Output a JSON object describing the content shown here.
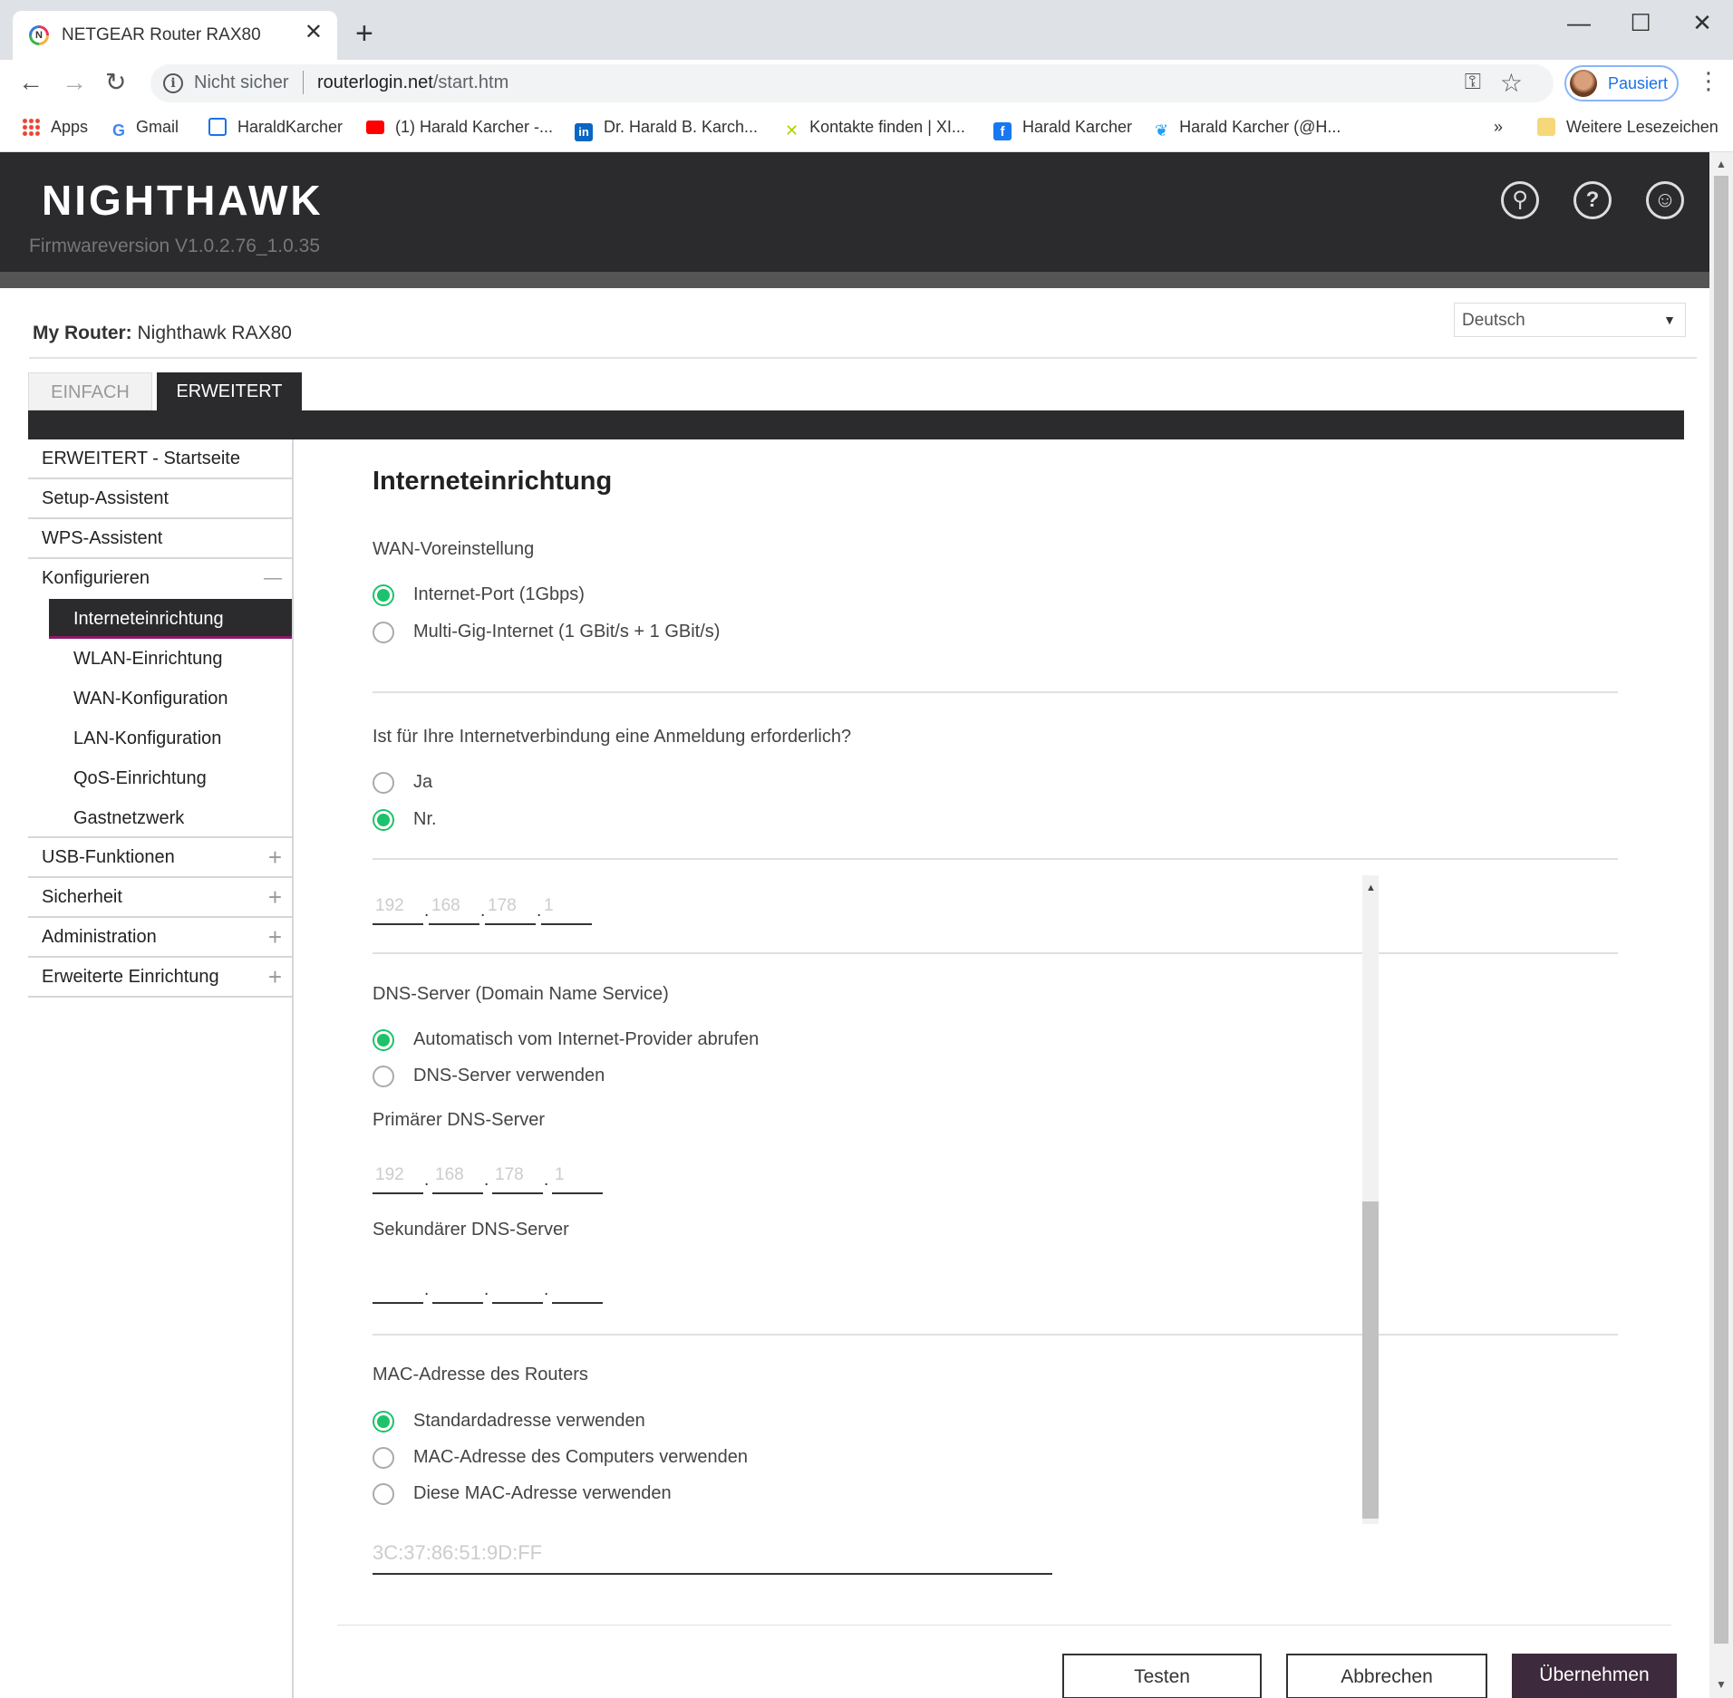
{
  "browser": {
    "tab_title": "NETGEAR Router RAX80",
    "tab_close": "✕",
    "new_tab": "+",
    "window_controls": {
      "minimize": "—",
      "maximize": "☐",
      "close": "✕"
    },
    "nav": {
      "back": "←",
      "forward": "→",
      "reload": "↻"
    },
    "security_label": "Nicht sicher",
    "url_host": "routerlogin.net",
    "url_path": "/start.htm",
    "profile_label": "Pausiert",
    "menu": "⋮",
    "bookmarks": [
      {
        "label": "Apps",
        "icon": "apps-grid-icon",
        "color": "#4285f4"
      },
      {
        "label": "Gmail",
        "icon": "google-icon",
        "color": "#ea4335"
      },
      {
        "label": "HaraldKarcher",
        "icon": "page-icon",
        "color": "#1a73e8"
      },
      {
        "label": "(1) Harald Karcher -...",
        "icon": "youtube-icon",
        "color": "#ff0000"
      },
      {
        "label": "Dr. Harald B. Karch...",
        "icon": "linkedin-icon",
        "color": "#0a66c2"
      },
      {
        "label": "Kontakte finden | XI...",
        "icon": "xing-icon",
        "color": "#b0d400"
      },
      {
        "label": "Harald Karcher",
        "icon": "facebook-icon",
        "color": "#1877f2"
      },
      {
        "label": "Harald Karcher (@H...",
        "icon": "twitter-icon",
        "color": "#1da1f2"
      }
    ],
    "bookmarks_overflow": "»",
    "other_bookmarks": "Weitere Lesezeichen"
  },
  "header": {
    "logo": "NIGHTHAWK",
    "firmware": "Firmwareversion V1.0.2.76_1.0.35",
    "icons": [
      "search-icon",
      "help-icon",
      "account-icon"
    ]
  },
  "router": {
    "label": "My Router:",
    "name": "Nighthawk RAX80",
    "language": "Deutsch"
  },
  "tabs": {
    "basic": "EINFACH",
    "advanced": "ERWEITERT"
  },
  "sidebar": {
    "top": [
      "ERWEITERT - Startseite",
      "Setup-Assistent",
      "WPS-Assistent"
    ],
    "configure": "Konfigurieren",
    "configure_sub": [
      "Interneteinrichtung",
      "WLAN-Einrichtung",
      "WAN-Konfiguration",
      "LAN-Konfiguration",
      "QoS-Einrichtung",
      "Gastnetzwerk"
    ],
    "bottom": [
      "USB-Funktionen",
      "Sicherheit",
      "Administration",
      "Erweiterte Einrichtung"
    ],
    "collapse_symbol": "—",
    "expand_symbol": "+"
  },
  "main": {
    "title": "Interneteinrichtung",
    "wan": {
      "label": "WAN-Voreinstellung",
      "options": [
        "Internet-Port (1Gbps)",
        "Multi-Gig-Internet (1 GBit/s + 1 GBit/s)"
      ],
      "selected": 0
    },
    "login": {
      "question": "Ist für Ihre Internetverbindung eine Anmeldung erforderlich?",
      "options": [
        "Ja",
        "Nr."
      ],
      "selected": 1
    },
    "ip_placeholder": [
      "192",
      "168",
      "178",
      "1"
    ],
    "dns": {
      "label": "DNS-Server (Domain Name Service)",
      "options": [
        "Automatisch vom Internet-Provider abrufen",
        "DNS-Server verwenden"
      ],
      "selected": 0,
      "primary_label": "Primärer DNS-Server",
      "primary_placeholder": [
        "192",
        "168",
        "178",
        "1"
      ],
      "secondary_label": "Sekundärer DNS-Server"
    },
    "mac": {
      "label": "MAC-Adresse des Routers",
      "options": [
        "Standardadresse verwenden",
        "MAC-Adresse des Computers verwenden",
        "Diese MAC-Adresse verwenden"
      ],
      "selected": 0,
      "placeholder": "3C:37:86:51:9D:FF"
    },
    "buttons": {
      "test": "Testen",
      "cancel": "Abbrechen",
      "apply": "Übernehmen"
    }
  },
  "colors": {
    "header_bg": "#2b2a2c",
    "radio_on": "#1dc26a",
    "apply_button": "#3d2a3c",
    "active_underline": "#8b1a6b"
  }
}
